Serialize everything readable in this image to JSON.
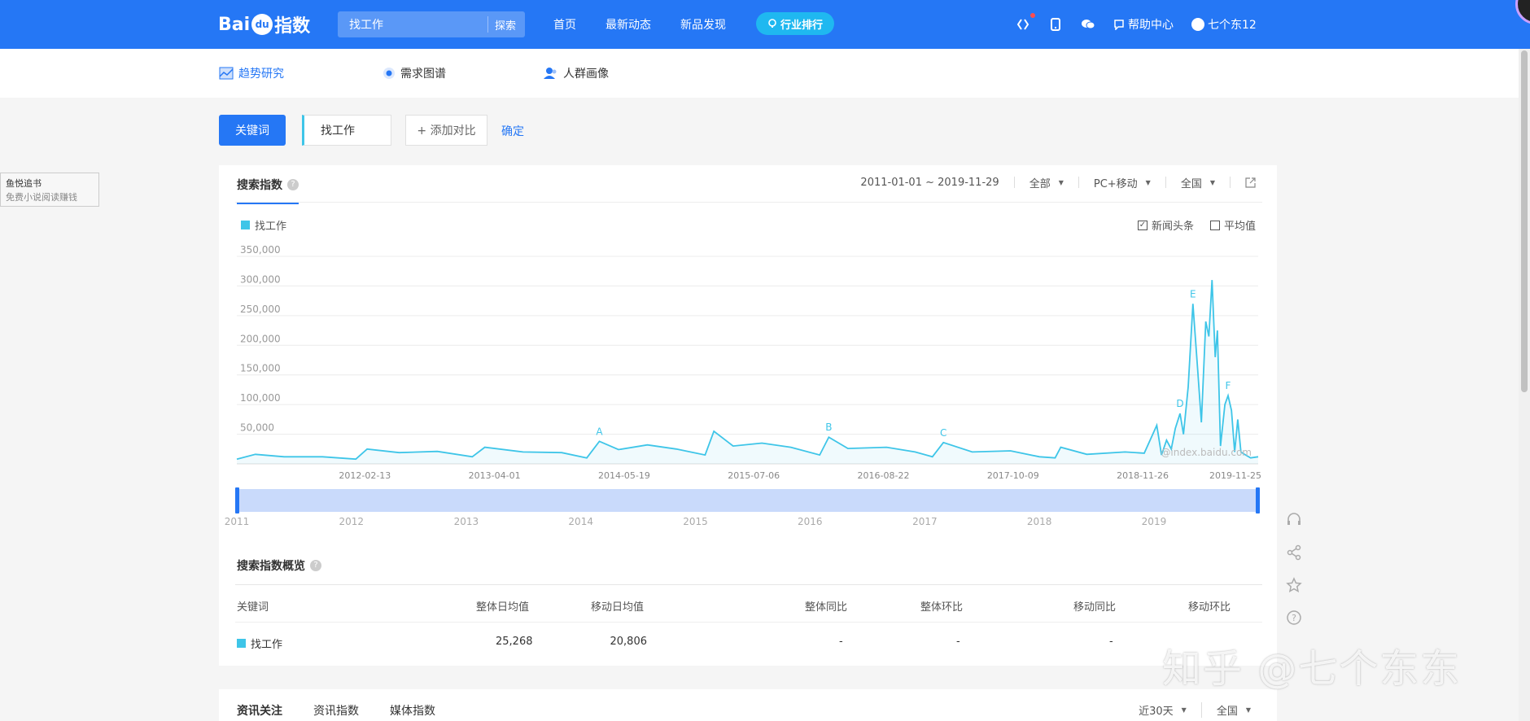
{
  "topbar": {
    "logo_text": "Bai",
    "logo_paw": "du",
    "logo_suffix": "指数",
    "search_value": "找工作",
    "search_button": "探索",
    "nav": [
      "首页",
      "最新动态",
      "新品发现"
    ],
    "rank_button": "行业排行",
    "help": "帮助中心",
    "user": "七个东12"
  },
  "subnav": {
    "items": [
      "趋势研究",
      "需求图谱",
      "人群画像"
    ]
  },
  "keyword": {
    "label": "关键词",
    "value": "找工作",
    "add_compare": "+ 添加对比",
    "confirm": "确定"
  },
  "side_ad": {
    "title": "鱼悦追书",
    "subtitle": "免费小说阅读赚钱"
  },
  "search_index": {
    "tab": "搜索指数",
    "date_range": "2011-01-01 ~ 2019-11-29",
    "source": "全部",
    "device": "PC+移动",
    "region": "全国",
    "check_news": "新闻头条",
    "check_avg": "平均值",
    "watermark": "@index.baidu.com"
  },
  "chart_data": {
    "type": "line",
    "series": [
      {
        "name": "找工作",
        "color": "#3ec5e8"
      }
    ],
    "ylim": [
      0,
      350000
    ],
    "yticks": [
      "350,000",
      "300,000",
      "250,000",
      "200,000",
      "150,000",
      "100,000",
      "50,000"
    ],
    "xticks": [
      "2012-02-13",
      "2013-04-01",
      "2014-05-19",
      "2015-07-06",
      "2016-08-22",
      "2017-10-09",
      "2018-11-26",
      "2019-11-25"
    ],
    "points": [
      [
        "2011-01-01",
        8000
      ],
      [
        "2011-03-01",
        16000
      ],
      [
        "2011-06-01",
        12000
      ],
      [
        "2011-10-01",
        12000
      ],
      [
        "2012-01-15",
        8000
      ],
      [
        "2012-02-20",
        25000
      ],
      [
        "2012-06-01",
        19000
      ],
      [
        "2012-10-01",
        21000
      ],
      [
        "2013-01-20",
        12000
      ],
      [
        "2013-03-01",
        28000
      ],
      [
        "2013-07-01",
        20000
      ],
      [
        "2013-11-01",
        19000
      ],
      [
        "2014-01-20",
        10000
      ],
      [
        "2014-03-01",
        38000
      ],
      [
        "2014-05-01",
        24000
      ],
      [
        "2014-08-01",
        32000
      ],
      [
        "2014-11-01",
        25000
      ],
      [
        "2015-02-01",
        15000
      ],
      [
        "2015-03-01",
        55000
      ],
      [
        "2015-05-01",
        30000
      ],
      [
        "2015-08-01",
        35000
      ],
      [
        "2015-11-01",
        28000
      ],
      [
        "2016-02-01",
        15000
      ],
      [
        "2016-03-01",
        45000
      ],
      [
        "2016-05-01",
        26000
      ],
      [
        "2016-09-01",
        28000
      ],
      [
        "2016-12-01",
        20000
      ],
      [
        "2017-01-25",
        12000
      ],
      [
        "2017-03-01",
        36000
      ],
      [
        "2017-06-01",
        20000
      ],
      [
        "2017-10-01",
        22000
      ],
      [
        "2018-01-01",
        12000
      ],
      [
        "2018-02-20",
        10000
      ],
      [
        "2018-03-10",
        28000
      ],
      [
        "2018-06-01",
        16000
      ],
      [
        "2018-10-01",
        20000
      ],
      [
        "2018-12-01",
        18000
      ],
      [
        "2019-01-10",
        65000
      ],
      [
        "2019-01-25",
        15000
      ],
      [
        "2019-02-10",
        40000
      ],
      [
        "2019-02-25",
        25000
      ],
      [
        "2019-03-10",
        60000
      ],
      [
        "2019-03-25",
        85000
      ],
      [
        "2019-04-05",
        50000
      ],
      [
        "2019-04-20",
        130000
      ],
      [
        "2019-05-05",
        270000
      ],
      [
        "2019-05-20",
        160000
      ],
      [
        "2019-06-01",
        70000
      ],
      [
        "2019-06-15",
        240000
      ],
      [
        "2019-06-25",
        215000
      ],
      [
        "2019-07-05",
        310000
      ],
      [
        "2019-07-15",
        180000
      ],
      [
        "2019-07-22",
        225000
      ],
      [
        "2019-08-01",
        30000
      ],
      [
        "2019-08-15",
        100000
      ],
      [
        "2019-08-25",
        115000
      ],
      [
        "2019-09-05",
        90000
      ],
      [
        "2019-09-15",
        20000
      ],
      [
        "2019-09-25",
        75000
      ],
      [
        "2019-10-05",
        20000
      ],
      [
        "2019-10-20",
        15000
      ],
      [
        "2019-11-05",
        10000
      ],
      [
        "2019-11-29",
        12000
      ]
    ],
    "annotations": [
      {
        "label": "A",
        "date": "2014-03-01"
      },
      {
        "label": "B",
        "date": "2016-03-01"
      },
      {
        "label": "C",
        "date": "2017-03-01"
      },
      {
        "label": "D",
        "date": "2019-03-25"
      },
      {
        "label": "E",
        "date": "2019-05-05"
      },
      {
        "label": "F",
        "date": "2019-08-25"
      }
    ],
    "slider_years": [
      "2011",
      "2012",
      "2013",
      "2014",
      "2015",
      "2016",
      "2017",
      "2018",
      "2019"
    ]
  },
  "overview": {
    "title": "搜索指数概览",
    "headers": [
      "关键词",
      "整体日均值",
      "移动日均值",
      "整体同比",
      "整体环比",
      "移动同比",
      "移动环比"
    ],
    "row": [
      "找工作",
      "25,268",
      "20,806",
      "-",
      "-",
      "-",
      ""
    ]
  },
  "news": {
    "tabs": [
      "资讯关注",
      "资讯指数",
      "媒体指数"
    ],
    "period": "近30天",
    "region": "全国"
  },
  "watermark": "知乎 @七个东东",
  "colors": {
    "brand": "#2577f5",
    "series": "#3ec5e8"
  }
}
